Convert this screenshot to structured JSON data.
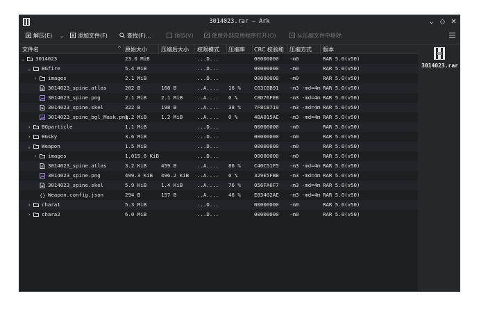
{
  "window": {
    "title": "3014023.rar — Ark"
  },
  "toolbar": {
    "extract": "解压(E)",
    "add_file": "添加文件(F)",
    "find": "查找(F)...",
    "preview": "预览(V)",
    "open_with": "使用外部应用程序打开(O)",
    "remove": "从压缩文件中移除"
  },
  "columns": {
    "name": "文件名",
    "size": "原始大小",
    "compressed": "压缩后大小",
    "perms": "权限模式",
    "ratio": "压缩率",
    "crc": "CRC 校验和",
    "method": "压缩方式",
    "version": "版本"
  },
  "rows": [
    {
      "level": 0,
      "arrow": "v",
      "icon": "folder",
      "name": "3014023",
      "size": "23.0 MiB",
      "compressed": "",
      "perms": "...D...",
      "ratio": "",
      "crc": "00000000",
      "method": "-m0",
      "version": "RAR 5.0(v50)"
    },
    {
      "level": 1,
      "arrow": "v",
      "icon": "folder",
      "name": "BGfire",
      "size": "5.4 MiB",
      "compressed": "",
      "perms": "...D...",
      "ratio": "",
      "crc": "00000000",
      "method": "-m0",
      "version": "RAR 5.0(v50)"
    },
    {
      "level": 2,
      "arrow": ">",
      "icon": "folder",
      "name": "images",
      "size": "2.1 MiB",
      "compressed": "",
      "perms": "...D...",
      "ratio": "",
      "crc": "00000000",
      "method": "-m0",
      "version": "RAR 5.0(v50)"
    },
    {
      "level": 2,
      "arrow": "",
      "icon": "file",
      "name": "3014023_spine.atlas",
      "size": "202 B",
      "compressed": "168 B",
      "perms": "..A....",
      "ratio": "16 %",
      "crc": "C63C6B91",
      "method": "-m3 -md=4m",
      "version": "RAR 5.0(v50)"
    },
    {
      "level": 2,
      "arrow": "",
      "icon": "image",
      "name": "3014023_spine.png",
      "size": "2.1 MiB",
      "compressed": "2.1 MiB",
      "perms": "..A....",
      "ratio": "0 %",
      "crc": "C8D76FEB",
      "method": "-m3 -md=4m",
      "version": "RAR 5.0(v50)"
    },
    {
      "level": 2,
      "arrow": "",
      "icon": "file",
      "name": "3014023_spine.skel",
      "size": "322 B",
      "compressed": "198 B",
      "perms": "..A....",
      "ratio": "38 %",
      "crc": "7F8C8719",
      "method": "-m3 -md=4m",
      "version": "RAR 5.0(v50)"
    },
    {
      "level": 2,
      "arrow": "",
      "icon": "image",
      "name": "3014023_spine_bgl_Mask.png",
      "size": "1.2 MiB",
      "compressed": "1.2 MiB",
      "perms": "..A....",
      "ratio": "0 %",
      "crc": "4BA015AE",
      "method": "-m3 -md=4m",
      "version": "RAR 5.0(v50)"
    },
    {
      "level": 1,
      "arrow": ">",
      "icon": "folder",
      "name": "BGparticle",
      "size": "1.1 MiB",
      "compressed": "",
      "perms": "...D...",
      "ratio": "",
      "crc": "00000000",
      "method": "-m0",
      "version": "RAR 5.0(v50)"
    },
    {
      "level": 1,
      "arrow": ">",
      "icon": "folder",
      "name": "BGsky",
      "size": "3.6 MiB",
      "compressed": "",
      "perms": "...D...",
      "ratio": "",
      "crc": "00000000",
      "method": "-m0",
      "version": "RAR 5.0(v50)"
    },
    {
      "level": 1,
      "arrow": "v",
      "icon": "folder",
      "name": "Weapon",
      "size": "1.5 MiB",
      "compressed": "",
      "perms": "...D...",
      "ratio": "",
      "crc": "00000000",
      "method": "-m0",
      "version": "RAR 5.0(v50)"
    },
    {
      "level": 2,
      "arrow": ">",
      "icon": "folder",
      "name": "images",
      "size": "1,015.6 KiB",
      "compressed": "",
      "perms": "...D...",
      "ratio": "",
      "crc": "00000000",
      "method": "-m0",
      "version": "RAR 5.0(v50)"
    },
    {
      "level": 2,
      "arrow": "",
      "icon": "file",
      "name": "3014023_spine.atlas",
      "size": "3.2 KiB",
      "compressed": "459 B",
      "perms": "..A....",
      "ratio": "86 %",
      "crc": "C40C51F5",
      "method": "-m3 -md=4m",
      "version": "RAR 5.0(v50)"
    },
    {
      "level": 2,
      "arrow": "",
      "icon": "image",
      "name": "3014023_spine.png",
      "size": "499.3 KiB",
      "compressed": "496.2 KiB",
      "perms": "..A....",
      "ratio": "0 %",
      "crc": "329E5FBB",
      "method": "-m3 -md=4m",
      "version": "RAR 5.0(v50)"
    },
    {
      "level": 2,
      "arrow": "",
      "icon": "file",
      "name": "3014023_spine.skel",
      "size": "5.9 KiB",
      "compressed": "1.4 KiB",
      "perms": "..A....",
      "ratio": "76 %",
      "crc": "056FA6F7",
      "method": "-m3 -md=4m",
      "version": "RAR 5.0(v50)"
    },
    {
      "level": 2,
      "arrow": "",
      "icon": "json",
      "name": "Weapon.config.json",
      "size": "294 B",
      "compressed": "157 B",
      "perms": "..A....",
      "ratio": "46 %",
      "crc": "E83402AE",
      "method": "-m3 -md=4m",
      "version": "RAR 5.0(v50)"
    },
    {
      "level": 1,
      "arrow": ">",
      "icon": "folder",
      "name": "chara1",
      "size": "5.3 MiB",
      "compressed": "",
      "perms": "...D...",
      "ratio": "",
      "crc": "00000000",
      "method": "-m0",
      "version": "RAR 5.0(v50)"
    },
    {
      "level": 1,
      "arrow": ">",
      "icon": "folder",
      "name": "chara2",
      "size": "6.0 MiB",
      "compressed": "",
      "perms": "...D...",
      "ratio": "",
      "crc": "00000000",
      "method": "-m0",
      "version": "RAR 5.0(v50)"
    }
  ],
  "side_panel": {
    "filename": "3014023.rar"
  }
}
